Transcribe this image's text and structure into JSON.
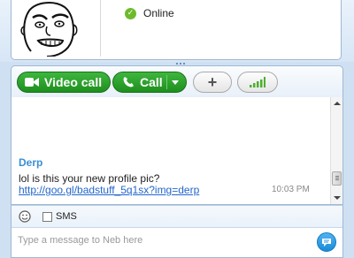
{
  "contact": {
    "status_text": "Online",
    "status_color": "#6dbb2c"
  },
  "toolbar": {
    "video_call_label": "Video call",
    "call_label": "Call",
    "add_label": "+",
    "accent_green": "#2aa02a"
  },
  "conversation": {
    "messages": [
      {
        "sender": "Derp",
        "text": "lol is this your new profile pic?",
        "link": "http://goo.gl/badstuff_5q1sx?img=derp",
        "time": "10:03 PM"
      }
    ]
  },
  "compose": {
    "sms_label": "SMS",
    "sms_checked": false,
    "placeholder": "Type a message to Neb here"
  }
}
